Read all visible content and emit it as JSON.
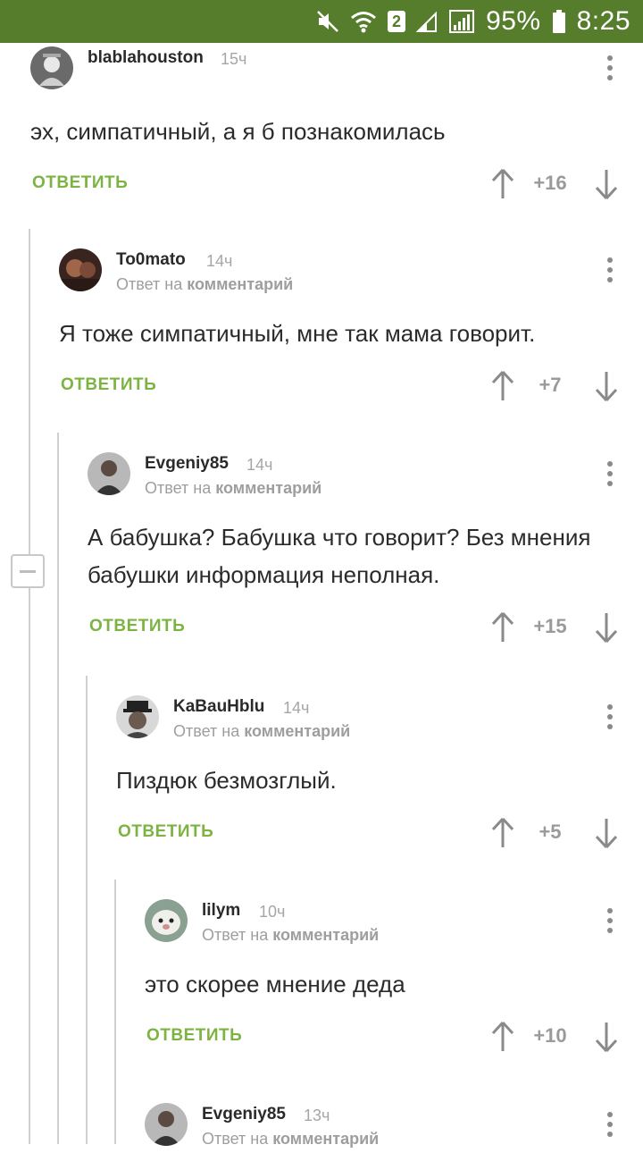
{
  "status_bar": {
    "signal_badge": "2",
    "battery": "95%",
    "time": "8:25",
    "icons": [
      "mute-icon",
      "wifi-icon",
      "signal-icon",
      "signal-icon",
      "battery-icon"
    ]
  },
  "reply_prefix": "Ответ на",
  "reply_target": "комментарий",
  "reply_label": "ОТВЕТИТЬ",
  "colors": {
    "status_bar": "#567d2b",
    "accent": "#7cb342"
  },
  "comments": [
    {
      "user": "blablahouston",
      "time": "15ч",
      "text": "эх, симпатичный, а я б познакомилась",
      "score": "+16"
    },
    {
      "user": "To0mato",
      "time": "14ч",
      "text": "Я тоже симпатичный, мне так мама говорит.",
      "score": "+7"
    },
    {
      "user": "Evgeniy85",
      "time": "14ч",
      "text": "А бабушка? Бабушка что говорит? Без мнения бабушки информация неполная.",
      "score": "+15"
    },
    {
      "user": "KaBauHblu",
      "time": "14ч",
      "text": "Пиздюк безмозглый.",
      "score": "+5"
    },
    {
      "user": "lilym",
      "time": "10ч",
      "text": "это скорее мнение деда",
      "score": "+10"
    },
    {
      "user": "Evgeniy85",
      "time": "13ч",
      "text": "",
      "score": ""
    }
  ]
}
